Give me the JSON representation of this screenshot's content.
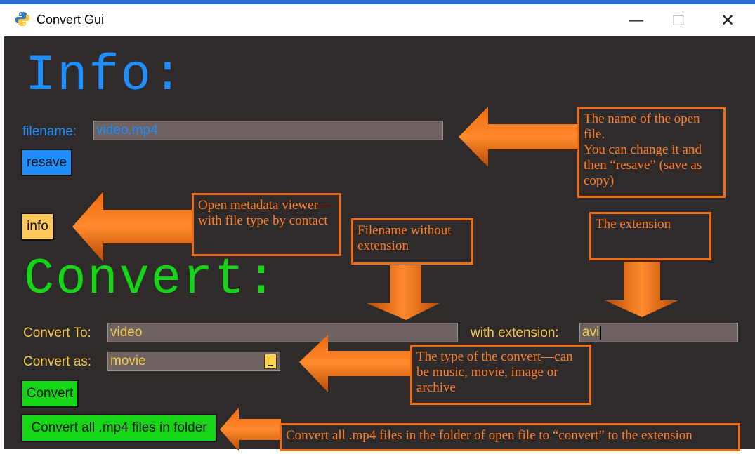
{
  "window": {
    "title": "Convert Gui",
    "minimize_symbol": "—",
    "maximize_symbol": "☐",
    "close_symbol": "✕"
  },
  "info": {
    "heading": "Info:",
    "filename_label": "filename:",
    "filename_value": "video.mp4",
    "resave_label": "resave",
    "info_label": "info"
  },
  "convert": {
    "heading": "Convert:",
    "convert_to_label": "Convert To:",
    "convert_to_value": "video",
    "extension_label": "with extension:",
    "extension_value": "avi",
    "convert_as_label": "Convert as:",
    "convert_as_value": "movie",
    "convert_button": "Convert",
    "convert_all_button": "Convert all .mp4 files in folder"
  },
  "annotations": {
    "filename_note": "The name of the open file.\nYou can change it and then “resave” (save as copy)",
    "info_note": "Open metadata viewer—with file type by contact",
    "filename_no_ext_note": "Filename without extension",
    "extension_note": "The extension",
    "convert_type_note": "The type of the convert—can be music, movie, image or archive",
    "convert_all_note": "Convert all .mp4 files in the folder of open file to “convert” to the extension"
  },
  "colors": {
    "background": "#2e2b2a",
    "info_accent": "#1f8fff",
    "convert_accent": "#16d416",
    "annotation": "#f06a10",
    "field": "#6e6360"
  },
  "icons": {
    "app": "python-logo-icon",
    "combo": "dropdown-arrow-icon"
  }
}
